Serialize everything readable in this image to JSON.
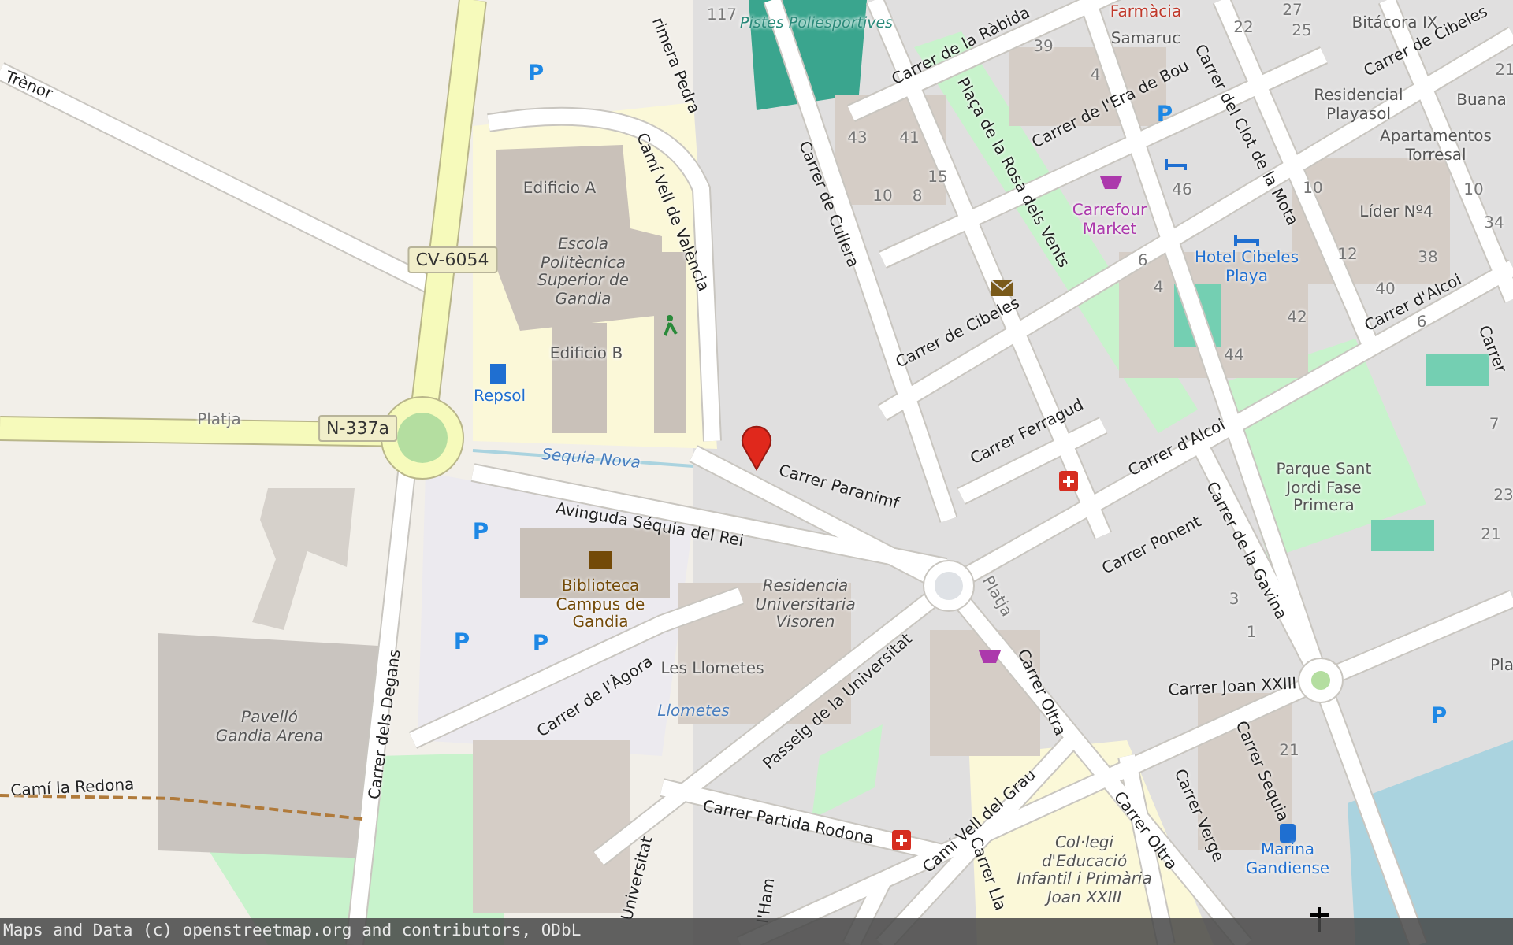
{
  "map": {
    "street_labels": [
      {
        "text": "Trènor",
        "kind": "street"
      },
      {
        "text": "Platja",
        "kind": "path"
      },
      {
        "text": "Camí Vell de València",
        "kind": "street"
      },
      {
        "text": "rimera Pedra",
        "kind": "street"
      },
      {
        "text": "Sequia Nova",
        "kind": "waterway"
      },
      {
        "text": "Carrer Paranimf",
        "kind": "street"
      },
      {
        "text": "Avinguda Séquia del Rei",
        "kind": "street"
      },
      {
        "text": "Carrer de Cullera",
        "kind": "street"
      },
      {
        "text": "Carrer de la Ràbida",
        "kind": "street"
      },
      {
        "text": "Plaça de la Rosa dels Vents",
        "kind": "street"
      },
      {
        "text": "Carrer de l'Era de Bou",
        "kind": "street"
      },
      {
        "text": "Carrer del Clot de la Mota",
        "kind": "street"
      },
      {
        "text": "Carrer de Cibeles",
        "kind": "street"
      },
      {
        "text": "Carrer de Cibeles",
        "kind": "street"
      },
      {
        "text": "Carrer Ferragud",
        "kind": "street"
      },
      {
        "text": "Carrer d'Alcoi",
        "kind": "street"
      },
      {
        "text": "Carrer d'Alcoi",
        "kind": "street"
      },
      {
        "text": "Carrer",
        "kind": "street"
      },
      {
        "text": "Carrer Ponent",
        "kind": "street"
      },
      {
        "text": "Carrer de la Gavina",
        "kind": "street"
      },
      {
        "text": "Carrer Joan XXIII",
        "kind": "street"
      },
      {
        "text": "Carrer Oltra",
        "kind": "street"
      },
      {
        "text": "Carrer Oltra",
        "kind": "street"
      },
      {
        "text": "Carrer Verge",
        "kind": "street"
      },
      {
        "text": "Carrer Sequia",
        "kind": "street"
      },
      {
        "text": "Platja",
        "kind": "path"
      },
      {
        "text": "Camí Vell del Grau",
        "kind": "street"
      },
      {
        "text": "Carrer Partida Rodona",
        "kind": "street"
      },
      {
        "text": "Passeig de la Universitat",
        "kind": "street"
      },
      {
        "text": "Carrer de l'Àgora",
        "kind": "street"
      },
      {
        "text": "Carrer dels Degans",
        "kind": "street"
      },
      {
        "text": "Camí la Redona",
        "kind": "street"
      },
      {
        "text": "Universitat",
        "kind": "street"
      },
      {
        "text": "l'Ham",
        "kind": "street"
      },
      {
        "text": "Carrer Lla",
        "kind": "street"
      }
    ],
    "road_shields": [
      "CV-6054",
      "N-337a"
    ],
    "place_labels": [
      {
        "text": "Pistes Poliesportives",
        "kind": "sport"
      },
      {
        "text": "Farmàcia",
        "kind": "pharmacy"
      },
      {
        "text": "Samaruc",
        "kind": "residential"
      },
      {
        "text": "Bitácora IX",
        "kind": "residential"
      },
      {
        "text": "Residencial Playasol",
        "kind": "residential"
      },
      {
        "text": "Buana",
        "kind": "residential"
      },
      {
        "text": "Apartamentos Torresal",
        "kind": "residential"
      },
      {
        "text": "Líder Nº4",
        "kind": "residential"
      },
      {
        "text": "Carrefour Market",
        "kind": "shop"
      },
      {
        "text": "Hotel Cibeles Playa",
        "kind": "hotel"
      },
      {
        "text": "Edificio A",
        "kind": "residential"
      },
      {
        "text": "Escola Politècnica Superior de Gandia",
        "kind": "education"
      },
      {
        "text": "Edificio B",
        "kind": "residential"
      },
      {
        "text": "Repsol",
        "kind": "hotel"
      },
      {
        "text": "Biblioteca Campus de Gandia",
        "kind": "library"
      },
      {
        "text": "Residencia Universitaria Visoren",
        "kind": "education"
      },
      {
        "text": "Les Llometes",
        "kind": "residential"
      },
      {
        "text": "Llometes",
        "kind": "water"
      },
      {
        "text": "Pavelló Gandia Arena",
        "kind": "education"
      },
      {
        "text": "Parque Sant Jordi Fase Primera",
        "kind": "residential"
      },
      {
        "text": "Col·legi d'Educació Infantil i Primària Joan XXIII",
        "kind": "education"
      },
      {
        "text": "Marina Gandiense",
        "kind": "hotel"
      },
      {
        "text": "Pla",
        "kind": "residential"
      }
    ],
    "house_numbers": [
      "117",
      "39",
      "4",
      "22",
      "27",
      "25",
      "43",
      "41",
      "15",
      "10",
      "8",
      "46",
      "10",
      "12",
      "38",
      "40",
      "10",
      "34",
      "6",
      "4",
      "42",
      "44",
      "6",
      "21",
      "7",
      "3",
      "1",
      "21",
      "21",
      "23"
    ],
    "parking_signs": [
      "P",
      "P",
      "P",
      "P",
      "P",
      "P"
    ]
  },
  "attribution": "Maps and Data (c) openstreetmap.org and contributors, ODbL"
}
